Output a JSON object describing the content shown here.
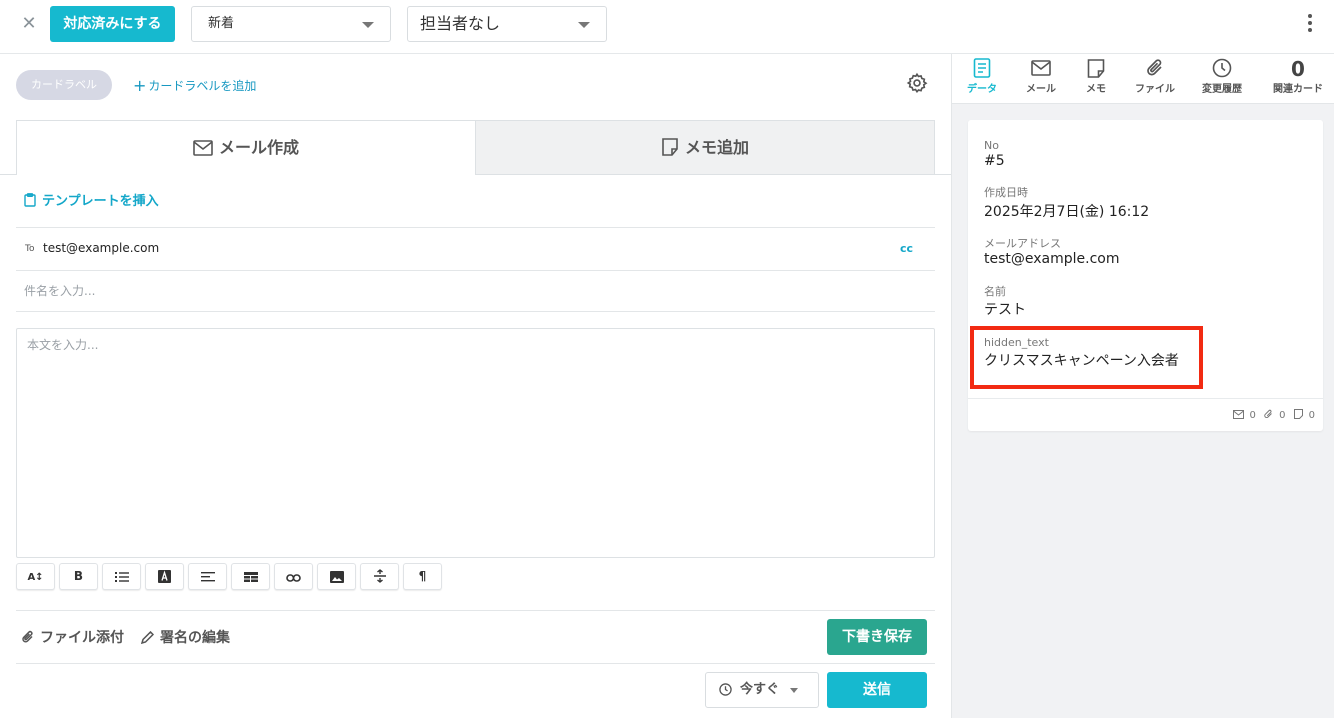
{
  "topbar": {
    "close_icon": "close-icon",
    "resolve_button": "対応済みにする",
    "status_select": "新着",
    "assignee_select": "担当者なし",
    "more_icon": "kebab-menu-icon"
  },
  "labels": {
    "chip": "カードラベル",
    "add": "カードラベルを追加",
    "add_prefix": "+"
  },
  "compose": {
    "tabs": [
      {
        "label": "メール作成",
        "icon": "mail-icon"
      },
      {
        "label": "メモ追加",
        "icon": "note-icon"
      }
    ],
    "template_link": "テンプレートを挿入",
    "to_label": "To",
    "to_value": "test@example.com",
    "cc_label": "cc",
    "subject_placeholder": "件名を入力...",
    "body_placeholder": "本文を入力...",
    "toolbar": {
      "font_size": "A↕",
      "bold": "B",
      "paragraph": "¶"
    },
    "attach_file": "ファイル添付",
    "edit_signature": "署名の編集",
    "save_draft": "下書き保存",
    "schedule": "今すぐ",
    "send": "送信"
  },
  "side": {
    "tabs": [
      {
        "label": "データ",
        "icon": "document-icon",
        "active": true
      },
      {
        "label": "メール",
        "icon": "mail-icon"
      },
      {
        "label": "メモ",
        "icon": "note-icon"
      },
      {
        "label": "ファイル",
        "icon": "paperclip-icon"
      },
      {
        "label": "変更履歴",
        "icon": "clock-icon"
      },
      {
        "label": "関連カード",
        "count": "0"
      }
    ],
    "fields": [
      {
        "label": "No",
        "value": "#5"
      },
      {
        "label": "作成日時",
        "value": "2025年2月7日(金) 16:12"
      },
      {
        "label": "メールアドレス",
        "value": "test@example.com"
      },
      {
        "label": "名前",
        "value": "テスト"
      },
      {
        "label": "hidden_text",
        "value": "クリスマスキャンペーン入会者"
      }
    ],
    "footer_counts": {
      "mail": "0",
      "file": "0",
      "memo": "0"
    },
    "highlight_color": "#f22a12"
  },
  "colors": {
    "primary": "#16b9cf",
    "draft": "#2aa68f",
    "link": "#14a7c9"
  }
}
